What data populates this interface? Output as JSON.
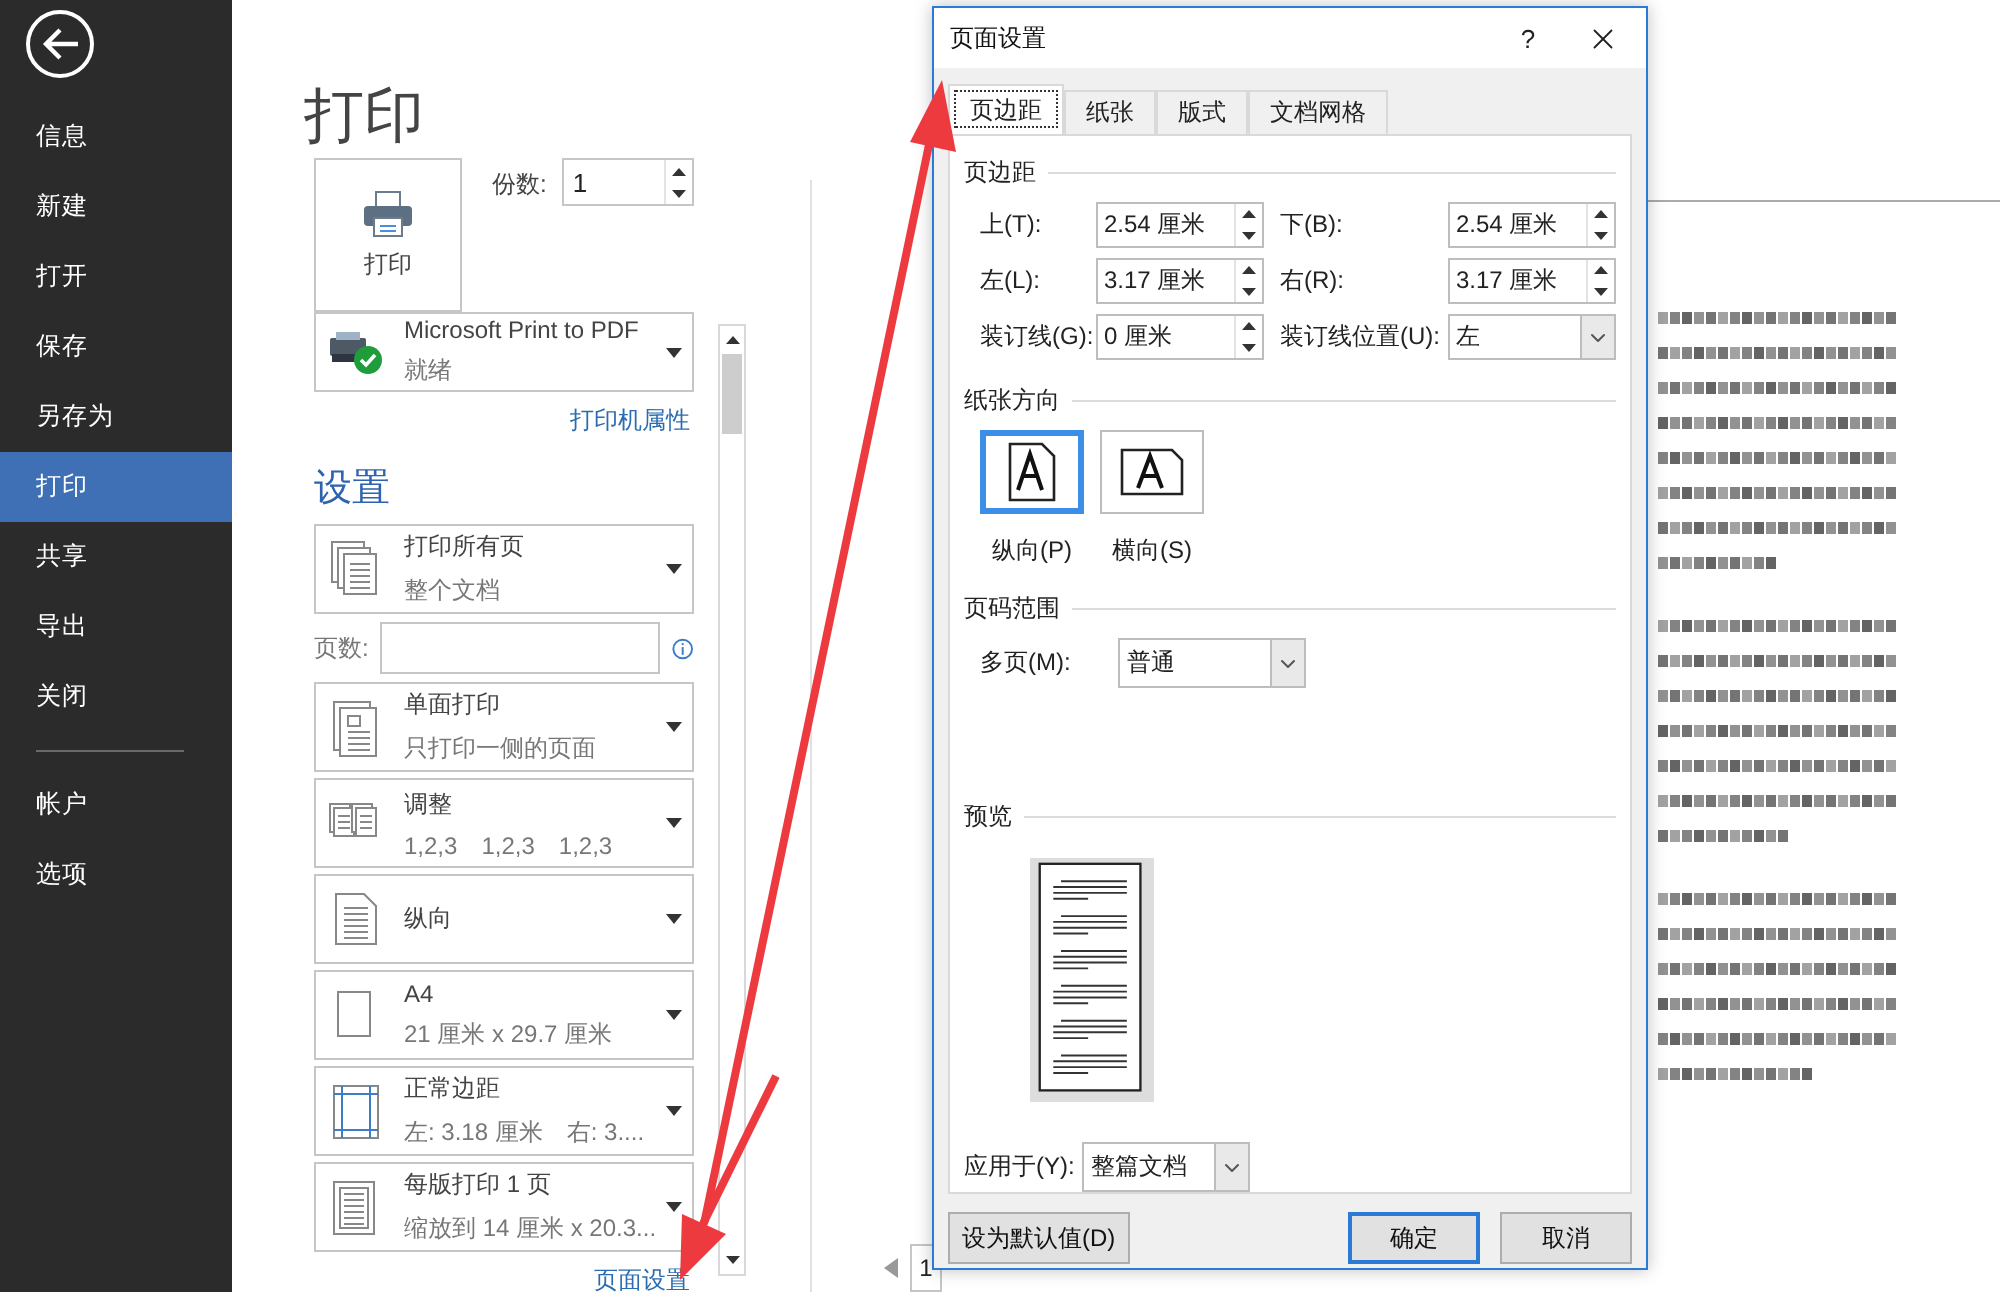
{
  "sidebar": {
    "items": [
      {
        "label": "信息",
        "selected": false
      },
      {
        "label": "新建",
        "selected": false
      },
      {
        "label": "打开",
        "selected": false
      },
      {
        "label": "保存",
        "selected": false
      },
      {
        "label": "另存为",
        "selected": false
      },
      {
        "label": "打印",
        "selected": true
      },
      {
        "label": "共享",
        "selected": false
      },
      {
        "label": "导出",
        "selected": false
      },
      {
        "label": "关闭",
        "selected": false
      }
    ],
    "footer_items": [
      {
        "label": "帐户",
        "selected": false
      },
      {
        "label": "选项",
        "selected": false
      }
    ]
  },
  "print": {
    "title": "打印",
    "print_button": "打印",
    "copies": {
      "label": "份数:",
      "value": "1"
    },
    "printer": {
      "name": "Microsoft Print to PDF",
      "status": "就绪"
    },
    "printer_properties": "打印机属性",
    "settings_heading": "设置",
    "settings": [
      {
        "kind": "pages",
        "title": "打印所有页",
        "subtitle": [
          "整个文档"
        ]
      },
      {
        "kind": "input",
        "label": "页数:"
      },
      {
        "kind": "single-sided",
        "title": "单面打印",
        "subtitle": [
          "只打印一侧的页面"
        ]
      },
      {
        "kind": "collate",
        "title": "调整",
        "subtitle": [
          "1,2,3",
          "1,2,3",
          "1,2,3"
        ]
      },
      {
        "kind": "portrait",
        "title": "纵向"
      },
      {
        "kind": "paper",
        "title": "A4",
        "subtitle": [
          "21 厘米 x 29.7 厘米"
        ]
      },
      {
        "kind": "margins",
        "title": "正常边距",
        "subtitle": [
          "左: 3.18 厘米",
          "右: 3...."
        ]
      },
      {
        "kind": "per-sheet",
        "title": "每版打印 1 页",
        "subtitle": [
          "缩放到 14 厘米 x 20.3..."
        ]
      }
    ],
    "page_setup_link": "页面设置"
  },
  "preview": {
    "page_number": "1"
  },
  "dialog": {
    "title": "页面设置",
    "help": "?",
    "tabs": [
      {
        "label": "页边距",
        "selected": true
      },
      {
        "label": "纸张",
        "selected": false
      },
      {
        "label": "版式",
        "selected": false
      },
      {
        "label": "文档网格",
        "selected": false
      }
    ],
    "margins": {
      "heading": "页边距",
      "fields": [
        {
          "kind": "spin",
          "label": "上(T):",
          "value": "2.54 厘米"
        },
        {
          "kind": "spin",
          "label": "下(B):",
          "value": "2.54 厘米"
        },
        {
          "kind": "spin",
          "label": "左(L):",
          "value": "3.17 厘米"
        },
        {
          "kind": "spin",
          "label": "右(R):",
          "value": "3.17 厘米"
        },
        {
          "kind": "spin",
          "label": "装订线(G):",
          "value": "0 厘米"
        },
        {
          "kind": "select",
          "label": "装订线位置(U):",
          "value": "左"
        }
      ]
    },
    "orientation": {
      "heading": "纸张方向",
      "options": [
        {
          "kind": "portrait",
          "label": "纵向(P)",
          "selected": true
        },
        {
          "kind": "landscape",
          "label": "横向(S)",
          "selected": false
        }
      ]
    },
    "pages": {
      "heading": "页码范围",
      "label": "多页(M):",
      "value": "普通"
    },
    "preview_heading": "预览",
    "apply_to": {
      "label": "应用于(Y):",
      "value": "整篇文档"
    },
    "buttons": [
      {
        "label": "设为默认值(D)",
        "default": false
      },
      {
        "label": "确定",
        "default": true
      },
      {
        "label": "取消",
        "default": false
      }
    ]
  }
}
